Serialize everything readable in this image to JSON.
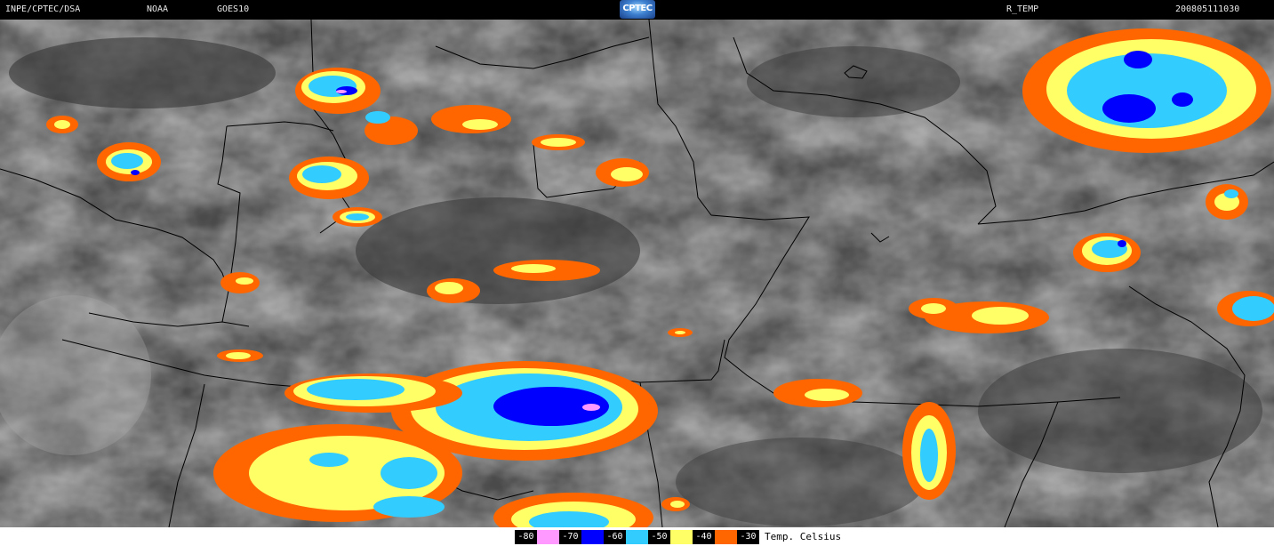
{
  "header": {
    "source": "INPE/CPTEC/DSA",
    "agency": "NOAA",
    "satellite": "GOES10",
    "logo": "CPTEC",
    "product": "R_TEMP",
    "timestamp": "200805111030"
  },
  "legend": {
    "unit_label": "Temp. Celsius",
    "entries": [
      {
        "value": "-80",
        "color": "#ff99ff"
      },
      {
        "value": "-70",
        "color": "#0000ff"
      },
      {
        "value": "-60",
        "color": "#33ccff"
      },
      {
        "value": "-50",
        "color": "#ffff66"
      },
      {
        "value": "-40",
        "color": "#ff6600"
      },
      {
        "value": "-30",
        "color": "#ffffff"
      }
    ]
  },
  "map": {
    "type": "satellite infrared enhanced image",
    "background_colors": [
      "#3a3a3a",
      "#6e6e6e",
      "#b4b4b4"
    ],
    "boundary_color": "#000000"
  }
}
